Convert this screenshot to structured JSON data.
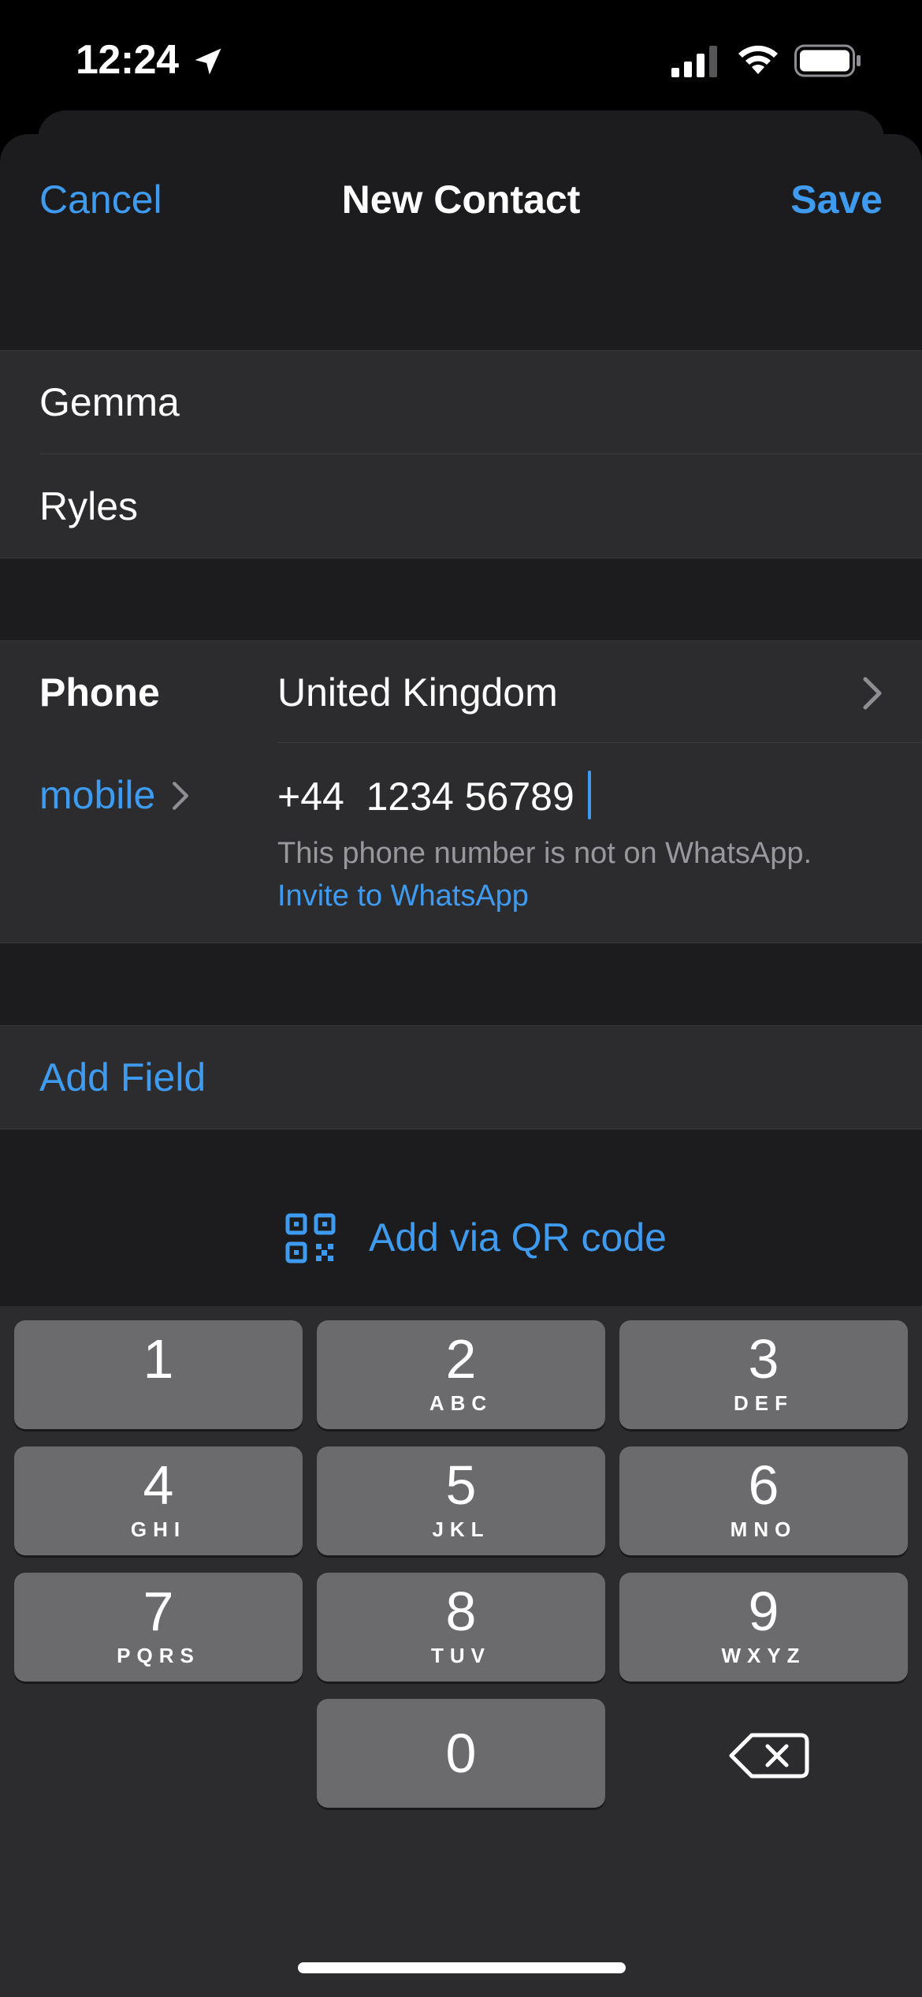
{
  "status": {
    "time": "12:24"
  },
  "nav": {
    "cancel": "Cancel",
    "title": "New Contact",
    "save": "Save"
  },
  "name": {
    "first": "Gemma",
    "last": "Ryles"
  },
  "phone": {
    "section_label": "Phone",
    "country": "United Kingdom",
    "type_label": "mobile",
    "number": "+44  1234 56789",
    "whatsapp_note": "This phone number is not on WhatsApp.",
    "whatsapp_invite": "Invite to WhatsApp"
  },
  "add_field": "Add Field",
  "qr": {
    "label": "Add via QR code"
  },
  "keypad": {
    "keys": [
      {
        "num": "1",
        "letters": ""
      },
      {
        "num": "2",
        "letters": "ABC"
      },
      {
        "num": "3",
        "letters": "DEF"
      },
      {
        "num": "4",
        "letters": "GHI"
      },
      {
        "num": "5",
        "letters": "JKL"
      },
      {
        "num": "6",
        "letters": "MNO"
      },
      {
        "num": "7",
        "letters": "PQRS"
      },
      {
        "num": "8",
        "letters": "TUV"
      },
      {
        "num": "9",
        "letters": "WXYZ"
      },
      {
        "num": "0",
        "letters": ""
      }
    ]
  },
  "colors": {
    "accent": "#3e9bf0",
    "sheet": "#1c1c1e",
    "cell": "#2c2c2e",
    "key": "#6b6b6e"
  }
}
